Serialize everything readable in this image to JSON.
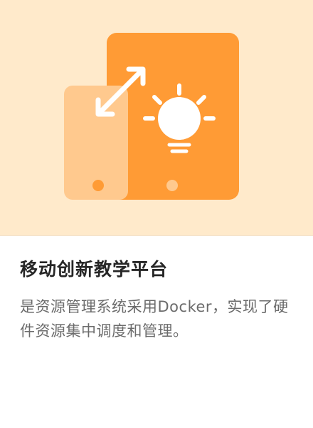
{
  "card": {
    "title": "移动创新教学平台",
    "description": "是资源管理系统采用Docker，实现了硬件资源集中调度和管理。"
  },
  "illustration": {
    "icons": [
      "tablet-icon",
      "phone-icon",
      "lightbulb-icon",
      "double-arrow-icon"
    ],
    "colors": {
      "background": "#FFEACB",
      "tablet": "#FF9B35",
      "phone": "#FFC98E",
      "accent_white": "#FFFFFF"
    }
  }
}
